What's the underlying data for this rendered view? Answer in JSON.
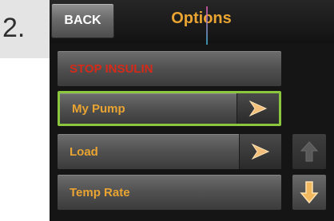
{
  "step": {
    "number": "2."
  },
  "header": {
    "back_label": "BACK",
    "title": "Options"
  },
  "menu": {
    "items": [
      {
        "label": "STOP INSULIN",
        "color": "#d42a1a",
        "has_arrow": false,
        "selected": false
      },
      {
        "label": "My Pump",
        "color": "#e9a431",
        "has_arrow": true,
        "selected": true
      },
      {
        "label": "Load",
        "color": "#e9a431",
        "has_arrow": true,
        "selected": false
      },
      {
        "label": "Temp Rate",
        "color": "#e9a431",
        "has_arrow": false,
        "selected": false
      }
    ]
  },
  "scroll": {
    "up_icon": "arrow-up-icon",
    "up_enabled": false,
    "down_icon": "arrow-down-icon",
    "down_enabled": true
  },
  "colors": {
    "accent": "#e9a431",
    "stop": "#d42a1a",
    "selection_border": "#8cc63f",
    "screen_background": "#151515"
  }
}
